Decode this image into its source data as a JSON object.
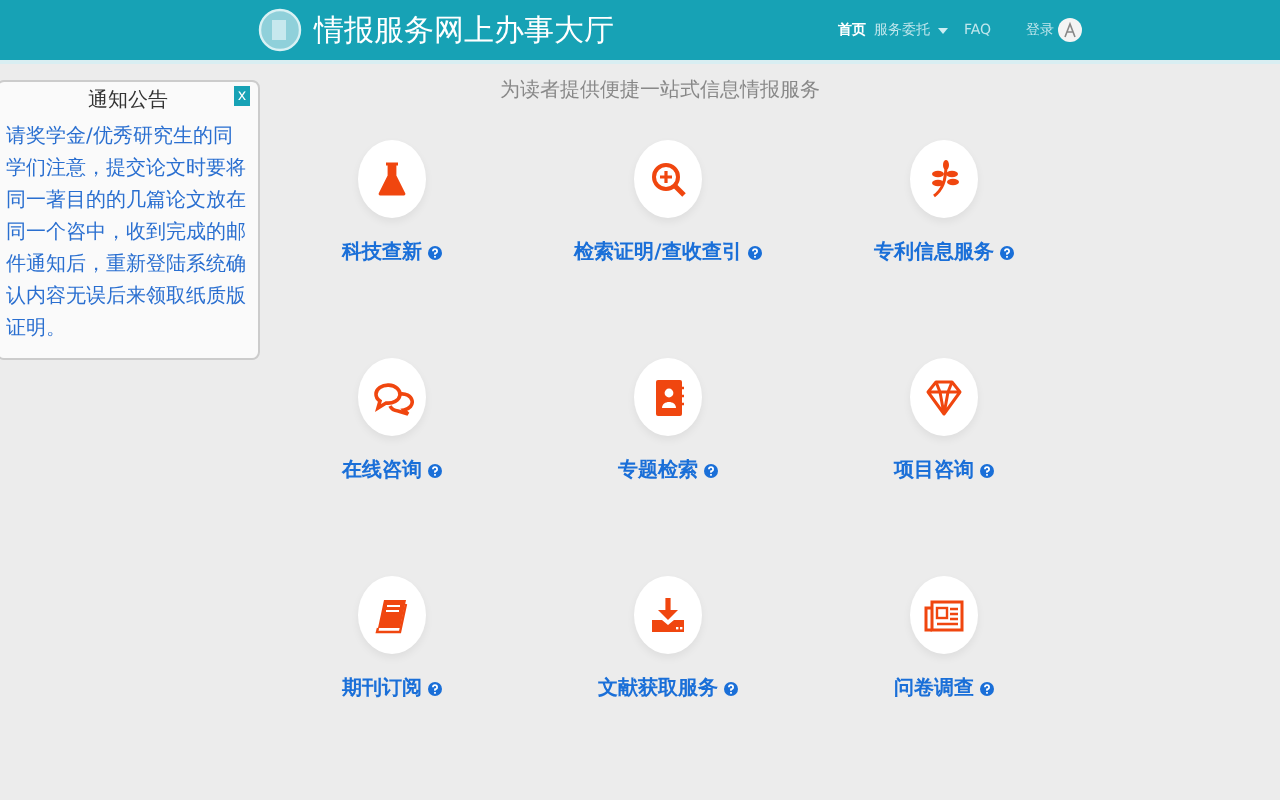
{
  "header": {
    "title": "情报服务网上办事大厅",
    "nav": [
      {
        "label": "首页",
        "selected": true,
        "dropdown": false
      },
      {
        "label": "服务委托",
        "selected": false,
        "dropdown": true
      },
      {
        "label": "FAQ",
        "selected": false,
        "dropdown": false
      }
    ],
    "login": "登录"
  },
  "subtitle": "为读者提供便捷一站式信息情报服务",
  "notice": {
    "title": "通知公告",
    "close": "x",
    "body": "请奖学金/优秀研究生的同学们注意，提交论文时要将同一著目的的几篇论文放在同一个咨中，收到完成的邮件通知后，重新登陆系统确认内容无误后来领取纸质版证明。"
  },
  "services": [
    {
      "label": "科技查新",
      "kind": "flask"
    },
    {
      "label": "检索证明/查收查引",
      "kind": "search"
    },
    {
      "label": "专利信息服务",
      "kind": "leaf"
    },
    {
      "label": "在线咨询",
      "kind": "chat"
    },
    {
      "label": "专题检索",
      "kind": "contacts"
    },
    {
      "label": "项目咨询",
      "kind": "diamond"
    },
    {
      "label": "期刊订阅",
      "kind": "book"
    },
    {
      "label": "文献获取服务",
      "kind": "download"
    },
    {
      "label": "问卷调查",
      "kind": "newspaper"
    }
  ]
}
